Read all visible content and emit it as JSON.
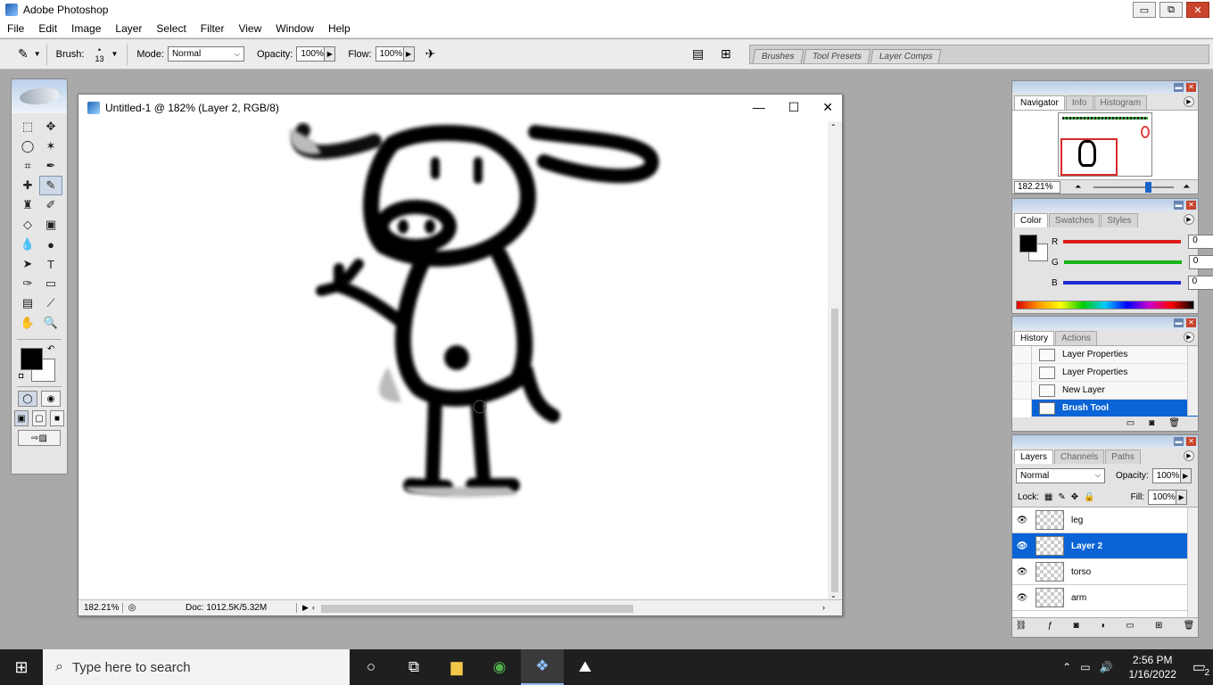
{
  "window": {
    "title": "Adobe Photoshop",
    "minimize": "▭",
    "maximize": "⧉",
    "close": "✕"
  },
  "menu": [
    "File",
    "Edit",
    "Image",
    "Layer",
    "Select",
    "Filter",
    "View",
    "Window",
    "Help"
  ],
  "options": {
    "brush_label": "Brush:",
    "brush_size": "13",
    "mode_label": "Mode:",
    "mode_value": "Normal",
    "opacity_label": "Opacity:",
    "opacity_value": "100%",
    "flow_label": "Flow:",
    "flow_value": "100%",
    "well_tabs": [
      "Brushes",
      "Tool Presets",
      "Layer Comps"
    ]
  },
  "document": {
    "title": "Untitled-1 @ 182% (Layer 2, RGB/8)",
    "zoom": "182.21%",
    "doc_info": "Doc: 1012.5K/5.32M"
  },
  "navigator": {
    "tabs": [
      "Navigator",
      "Info",
      "Histogram"
    ],
    "zoom": "182.21%"
  },
  "color": {
    "tabs": [
      "Color",
      "Swatches",
      "Styles"
    ],
    "channels": [
      {
        "label": "R",
        "value": "0",
        "color": "#e01b1b"
      },
      {
        "label": "G",
        "value": "0",
        "color": "#16b516"
      },
      {
        "label": "B",
        "value": "0",
        "color": "#1f2bd6"
      }
    ]
  },
  "history": {
    "tabs": [
      "History",
      "Actions"
    ],
    "items": [
      "Layer Properties",
      "Layer Properties",
      "New Layer",
      "Brush Tool"
    ],
    "selected_index": 3
  },
  "layers": {
    "tabs": [
      "Layers",
      "Channels",
      "Paths"
    ],
    "blend_mode": "Normal",
    "opacity_label": "Opacity:",
    "opacity_value": "100%",
    "lock_label": "Lock:",
    "fill_label": "Fill:",
    "fill_value": "100%",
    "items": [
      "leg",
      "Layer 2",
      "torso",
      "arm"
    ],
    "selected_index": 1
  },
  "taskbar": {
    "search_placeholder": "Type here to search",
    "time": "2:56 PM",
    "date": "1/16/2022",
    "notifications": "2"
  }
}
